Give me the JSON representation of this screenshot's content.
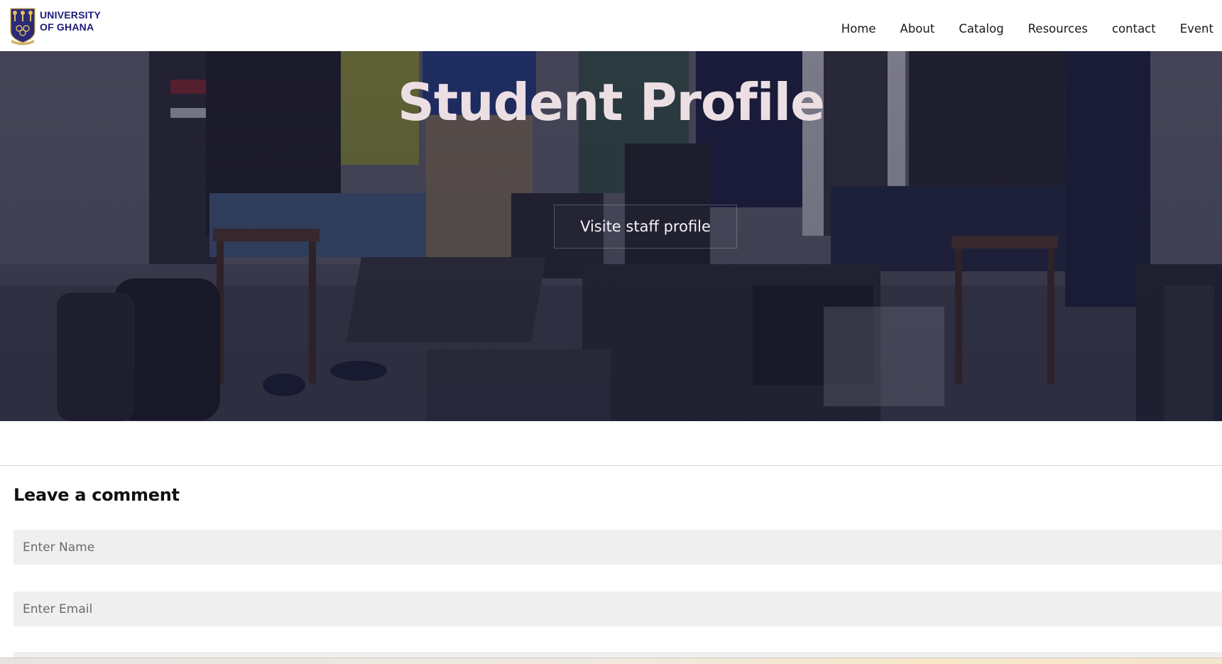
{
  "header": {
    "logo": {
      "line1": "UNIVERSITY",
      "line2": "OF GHANA",
      "brand_color": "#1b1b7a"
    },
    "nav": [
      {
        "label": "Home"
      },
      {
        "label": "About"
      },
      {
        "label": "Catalog"
      },
      {
        "label": "Resources"
      },
      {
        "label": "contact"
      },
      {
        "label": "Event"
      }
    ]
  },
  "hero": {
    "title": "Student Profile",
    "button_label": "Visite staff profile",
    "title_color": "#ecdfe3"
  },
  "comment": {
    "heading": "Leave a comment",
    "name_placeholder": "Enter Name",
    "email_placeholder": "Enter Email"
  }
}
